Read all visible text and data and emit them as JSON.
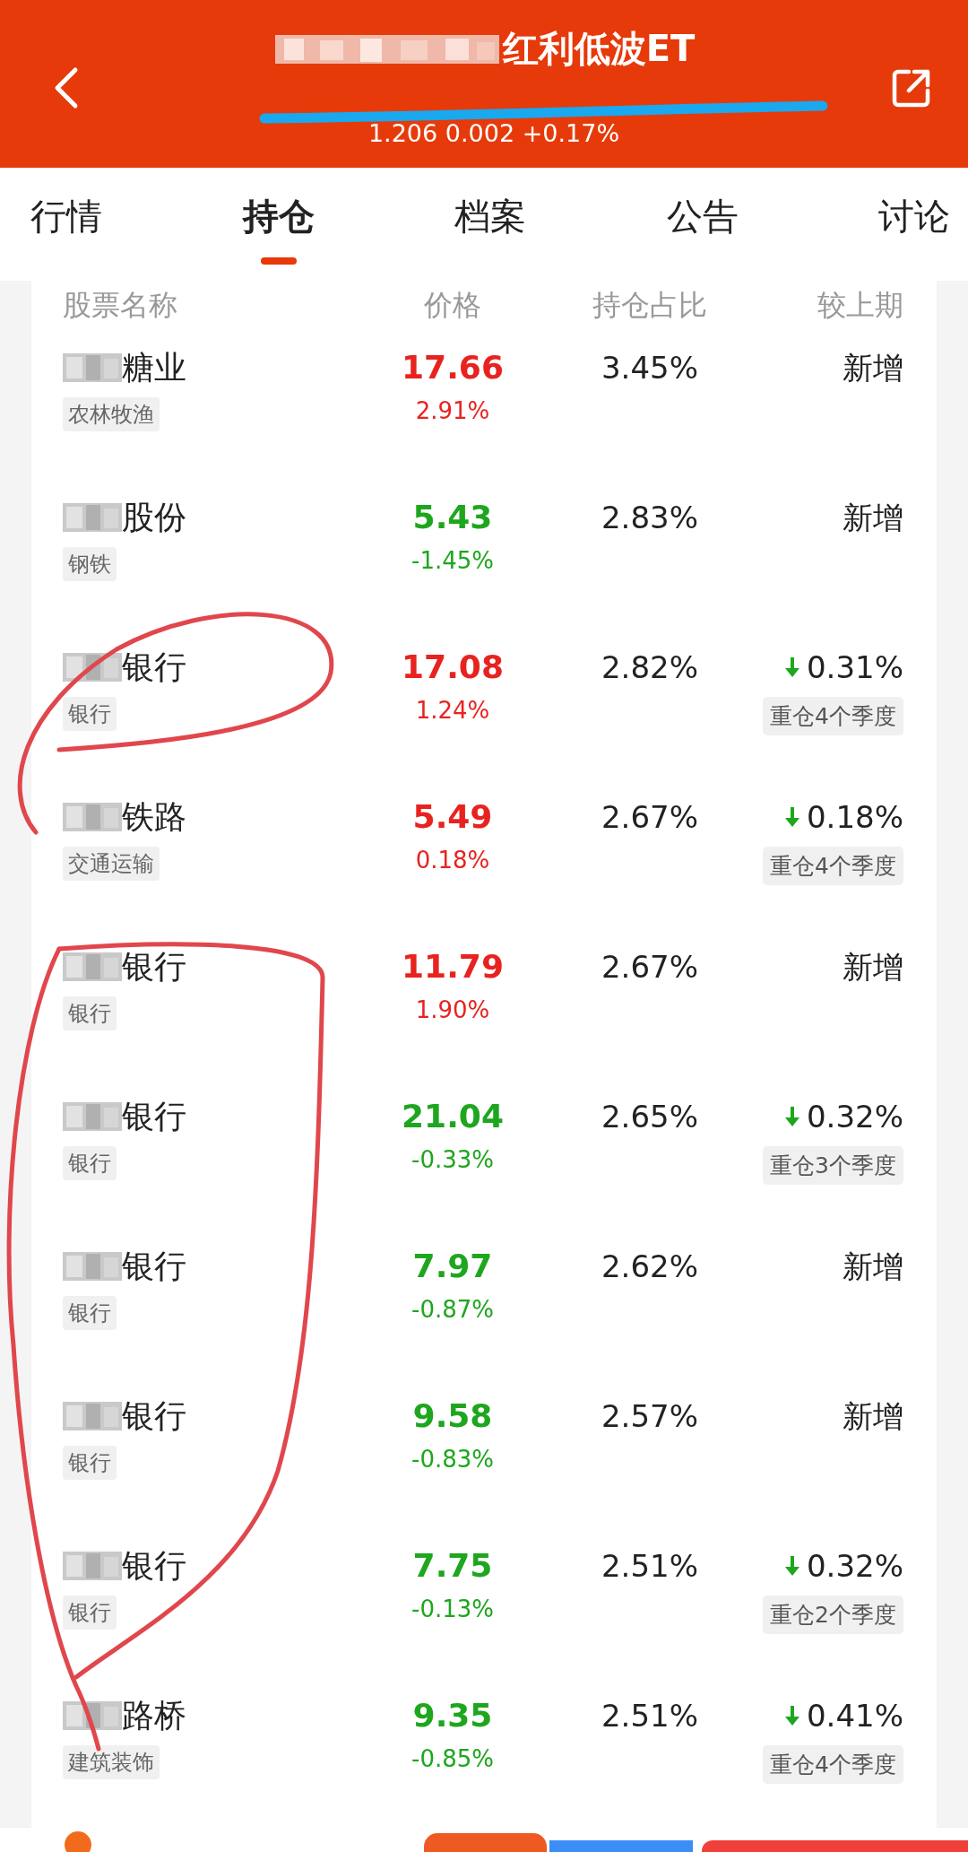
{
  "header": {
    "title": "红利低波ET",
    "quote": "1.206 0.002 +0.17%"
  },
  "tabs": [
    {
      "label": "行情",
      "selected": false
    },
    {
      "label": "持仓",
      "selected": true
    },
    {
      "label": "档案",
      "selected": false
    },
    {
      "label": "公告",
      "selected": false
    },
    {
      "label": "讨论",
      "selected": false
    }
  ],
  "table": {
    "columns": [
      "股票名称",
      "价格",
      "持仓占比",
      "较上期"
    ],
    "rows": [
      {
        "name": "糖业",
        "industry": "农林牧渔",
        "price": "17.66",
        "pct": "2.91%",
        "rising": true,
        "share": "3.45%",
        "change": {
          "kind": "new",
          "text": "新增"
        }
      },
      {
        "name": "股份",
        "industry": "钢铁",
        "price": "5.43",
        "pct": "-1.45%",
        "rising": false,
        "share": "2.83%",
        "change": {
          "kind": "new",
          "text": "新增"
        }
      },
      {
        "name": "银行",
        "industry": "银行",
        "price": "17.08",
        "pct": "1.24%",
        "rising": true,
        "share": "2.82%",
        "change": {
          "kind": "down",
          "text": "0.31%",
          "tag": "重仓4个季度"
        }
      },
      {
        "name": "铁路",
        "industry": "交通运输",
        "price": "5.49",
        "pct": "0.18%",
        "rising": true,
        "share": "2.67%",
        "change": {
          "kind": "down",
          "text": "0.18%",
          "tag": "重仓4个季度"
        }
      },
      {
        "name": "银行",
        "industry": "银行",
        "price": "11.79",
        "pct": "1.90%",
        "rising": true,
        "share": "2.67%",
        "change": {
          "kind": "new",
          "text": "新增"
        }
      },
      {
        "name": "银行",
        "industry": "银行",
        "price": "21.04",
        "pct": "-0.33%",
        "rising": false,
        "share": "2.65%",
        "change": {
          "kind": "down",
          "text": "0.32%",
          "tag": "重仓3个季度"
        }
      },
      {
        "name": "银行",
        "industry": "银行",
        "price": "7.97",
        "pct": "-0.87%",
        "rising": false,
        "share": "2.62%",
        "change": {
          "kind": "new",
          "text": "新增"
        }
      },
      {
        "name": "银行",
        "industry": "银行",
        "price": "9.58",
        "pct": "-0.83%",
        "rising": false,
        "share": "2.57%",
        "change": {
          "kind": "new",
          "text": "新增"
        }
      },
      {
        "name": "银行",
        "industry": "银行",
        "price": "7.75",
        "pct": "-0.13%",
        "rising": false,
        "share": "2.51%",
        "change": {
          "kind": "down",
          "text": "0.32%",
          "tag": "重仓2个季度"
        }
      },
      {
        "name": "路桥",
        "industry": "建筑装饰",
        "price": "9.35",
        "pct": "-0.85%",
        "rising": false,
        "share": "2.51%",
        "change": {
          "kind": "down",
          "text": "0.41%",
          "tag": "重仓4个季度"
        }
      }
    ]
  }
}
